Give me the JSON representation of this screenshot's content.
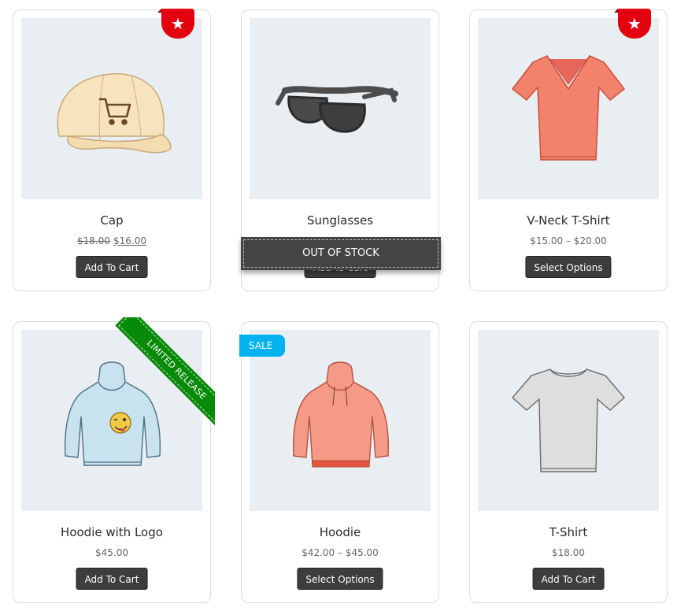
{
  "products": [
    {
      "title": "Cap",
      "price_old": "$18.00",
      "price_new": "$16.00",
      "button": "Add To Cart",
      "badge": "star-icon"
    },
    {
      "title": "Sunglasses",
      "overlay": "OUT OF STOCK",
      "button": "Add To Cart"
    },
    {
      "title": "V-Neck T-Shirt",
      "price_range": "$15.00 – $20.00",
      "button": "Select Options",
      "badge": "star-icon"
    },
    {
      "title": "Hoodie with Logo",
      "price": "$45.00",
      "button": "Add To Cart",
      "ribbon": "LIMITED RELEASE"
    },
    {
      "title": "Hoodie",
      "price_range": "$42.00 – $45.00",
      "button": "Select Options",
      "badge_text": "SALE"
    },
    {
      "title": "T-Shirt",
      "price": "$18.00",
      "button": "Add To Cart"
    }
  ],
  "colors": {
    "thumb_bg": "#e9eef2",
    "star_badge": "#e3000f",
    "sale_badge": "#00b3f0",
    "ribbon": "#078a07",
    "button_bg": "#3d3d3d",
    "oos_band": "#444444"
  },
  "icons": {
    "star": "★",
    "cart": "cart-icon"
  }
}
